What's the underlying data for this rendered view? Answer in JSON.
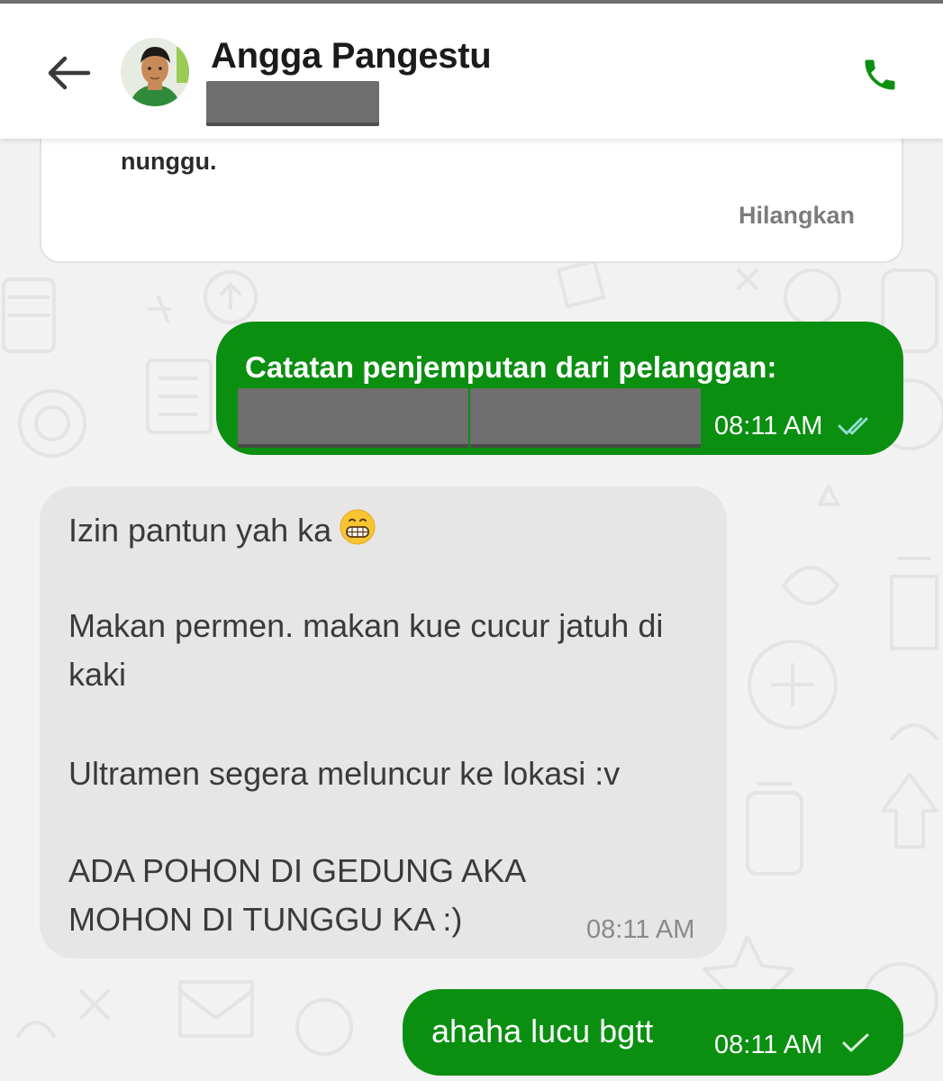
{
  "header": {
    "contact_name": "Angga Pangestu",
    "accent_color": "#0a8f11"
  },
  "notice": {
    "text": "nunggu.",
    "dismiss_label": "Hilangkan"
  },
  "messages": [
    {
      "direction": "outgoing",
      "title": "Catatan penjemputan dari pelanggan:",
      "time": "08:11 AM",
      "status": "read-double-tick"
    },
    {
      "direction": "incoming",
      "lines": [
        "Izin pantun yah ka",
        "Makan permen. makan kue cucur jatuh di",
        "kaki",
        "Ultramen segera meluncur ke lokasi :v",
        "ADA POHON DI GEDUNG AKA",
        "MOHON DI TUNGGU KA :)"
      ],
      "emoji": "grinning-face-icon",
      "time": "08:11 AM"
    },
    {
      "direction": "outgoing",
      "text": "ahaha lucu bgtt",
      "time": "08:11 AM",
      "status": "sent-single-tick"
    }
  ],
  "colors": {
    "outgoing_bubble": "#0a8f11",
    "incoming_bubble": "#e6e6e6",
    "background": "#f2f2f2",
    "read_tick": "#8ee0d0"
  }
}
